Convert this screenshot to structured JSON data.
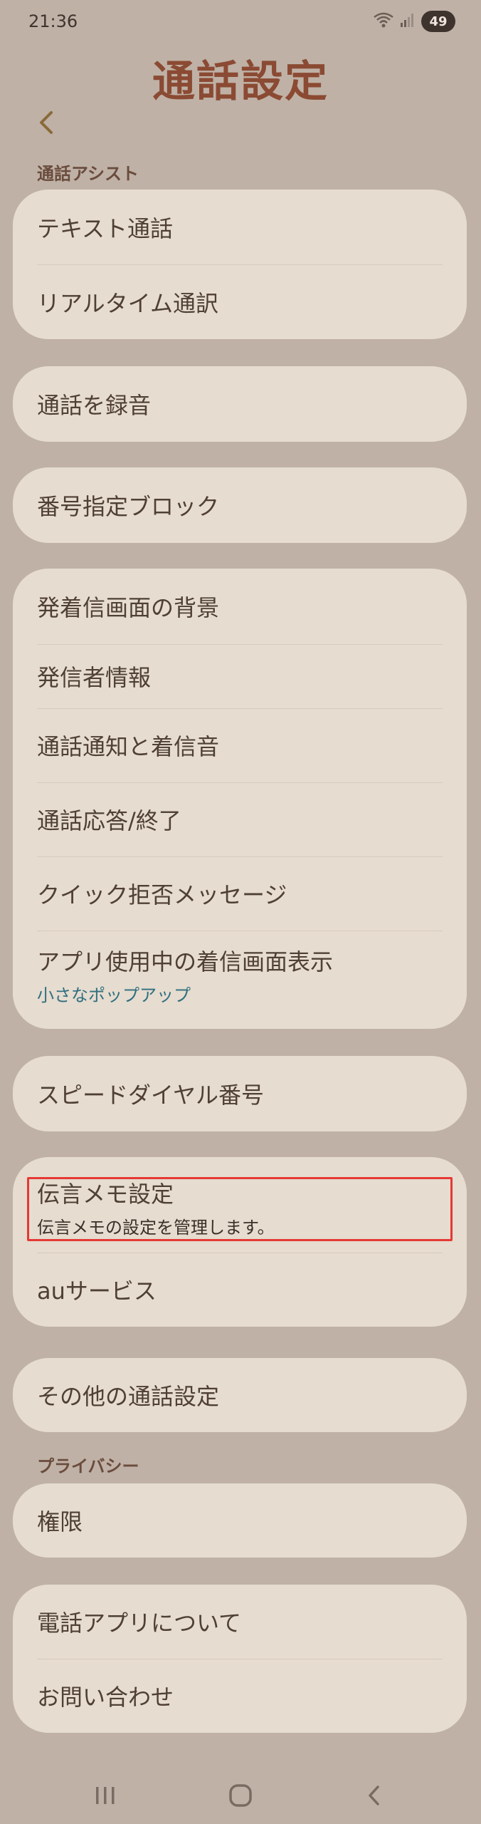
{
  "status": {
    "time": "21:36",
    "battery": "49"
  },
  "page": {
    "title": "通話設定"
  },
  "sections": {
    "assist_header": "通話アシスト",
    "privacy_header": "プライバシー"
  },
  "cards": {
    "assist": [
      "テキスト通話",
      "リアルタイム通訳"
    ],
    "record": "通話を録音",
    "block": "番号指定ブロック",
    "display_group": {
      "background": "発着信画面の背景",
      "caller_info": "発信者情報",
      "notification_ringtone": "通話通知と着信音",
      "answer_end": "通話応答/終了",
      "quick_decline": "クイック拒否メッセージ",
      "in_app_display": {
        "title": "アプリ使用中の着信画面表示",
        "subtitle": "小さなポップアップ"
      }
    },
    "speed_dial": "スピードダイヤル番号",
    "voicemail_group": {
      "voicemail": {
        "title": "伝言メモ設定",
        "subtitle": "伝言メモの設定を管理します。"
      },
      "au_services": "auサービス"
    },
    "other": "その他の通話設定",
    "permissions": "権限",
    "about_group": {
      "about": "電話アプリについて",
      "contact": "お問い合わせ"
    }
  },
  "colors": {
    "background": "#bfb1a6",
    "card": "#e6dccf",
    "title": "#8b4a33",
    "accent_link": "#2f6f80",
    "highlight": "#e53935"
  }
}
